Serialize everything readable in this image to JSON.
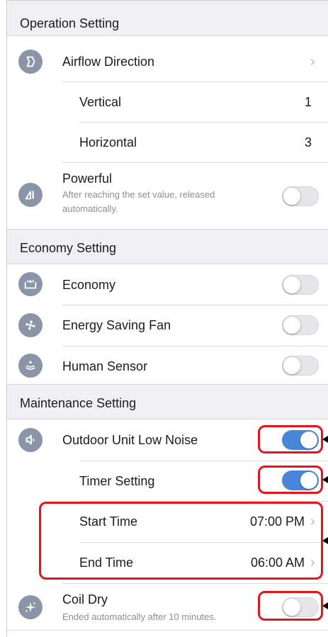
{
  "sections": {
    "operation": {
      "title": "Operation Setting",
      "airflow": {
        "label": "Airflow Direction",
        "icon": "airflow-icon"
      },
      "vertical": {
        "label": "Vertical",
        "value": "1"
      },
      "horizontal": {
        "label": "Horizontal",
        "value": "3"
      },
      "powerful": {
        "label": "Powerful",
        "description": "After reaching the set value, released automatically.",
        "on": false,
        "icon": "powerful-icon"
      }
    },
    "economy": {
      "title": "Economy Setting",
      "economy": {
        "label": "Economy",
        "on": false,
        "icon": "economy-icon"
      },
      "energy_saving_fan": {
        "label": "Energy Saving Fan",
        "on": false,
        "icon": "fan-icon"
      },
      "human_sensor": {
        "label": "Human Sensor",
        "on": false,
        "icon": "human-sensor-icon"
      }
    },
    "maintenance": {
      "title": "Maintenance Setting",
      "outdoor_low_noise": {
        "label": "Outdoor Unit Low Noise",
        "on": true,
        "icon": "low-noise-icon"
      },
      "timer_setting": {
        "label": "Timer Setting",
        "on": true
      },
      "start_time": {
        "label": "Start Time",
        "value": "07:00 PM"
      },
      "end_time": {
        "label": "End Time",
        "value": "06:00 AM"
      },
      "coil_dry": {
        "label": "Coil Dry",
        "description": "Ended automatically after 10 minutes.",
        "on": false,
        "icon": "coil-dry-icon"
      }
    }
  },
  "colors": {
    "accent": "#4a86d8",
    "icon_bg": "#8b95a8",
    "callout": "#e8141c",
    "section_bg": "#efeff4"
  }
}
